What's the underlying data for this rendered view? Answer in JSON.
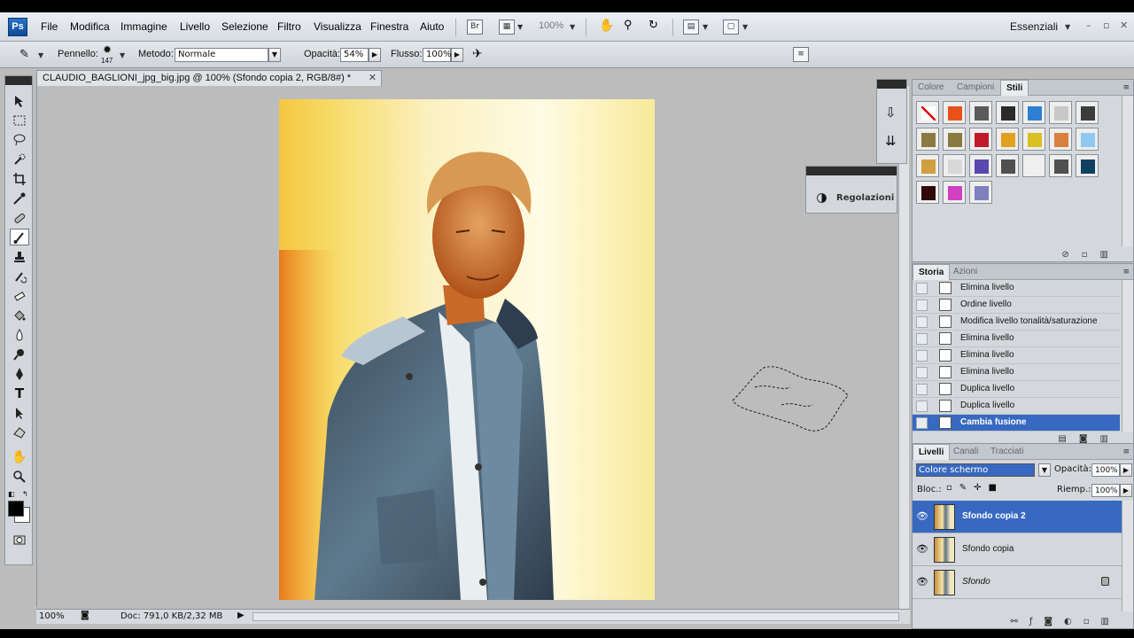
{
  "menubar": {
    "logo": "Ps",
    "items": [
      "File",
      "Modifica",
      "Immagine",
      "Livello",
      "Selezione",
      "Filtro",
      "Visualizza",
      "Finestra",
      "Aiuto"
    ],
    "bridge_label": "Br",
    "zoom": "100%",
    "workspace": "Essenziali",
    "window_controls": [
      "–",
      "▫",
      "✕"
    ]
  },
  "options": {
    "brush_label": "Pennello:",
    "brush_size": "147",
    "mode_label": "Metodo:",
    "mode_value": "Normale",
    "opacity_label": "Opacità:",
    "opacity_value": "54%",
    "flow_label": "Flusso:",
    "flow_value": "100%"
  },
  "document": {
    "tab_title": "CLAUDIO_BAGLIONI_jpg_big.jpg @ 100% (Sfondo copia 2, RGB/8#) *",
    "close": "✕",
    "status_zoom": "100%",
    "status_doc": "Doc: 791,0 KB/2,32 MB"
  },
  "regolazioni": {
    "label": "Regolazioni"
  },
  "swatch_panel": {
    "tabs": [
      "Colore",
      "Campioni",
      "Stili"
    ],
    "active_tab": "Stili",
    "swatch_colors": [
      "#ffffff",
      "#e8521a",
      "#5a5a5a",
      "#2a2a2a",
      "#2f7fd2",
      "#c8c8c8",
      "#3c3c3c",
      "#8a7a40",
      "#8a7a40",
      "#c01a2a",
      "#e0a020",
      "#d8c020",
      "#d88040",
      "#90c8f0",
      "#d0a040",
      "#d8d8d8",
      "#5848b0",
      "#505050",
      "#f0f0f0",
      "#505050",
      "#104060",
      "#300808",
      "#d040c0",
      "#8080c0"
    ]
  },
  "history_panel": {
    "tabs": [
      "Storia",
      "Azioni"
    ],
    "items": [
      "Elimina livello",
      "Ordine livello",
      "Modifica livello tonalità/saturazione",
      "Elimina livello",
      "Elimina livello",
      "Elimina livello",
      "Duplica livello",
      "Duplica livello",
      "Cambia fusione"
    ],
    "selected_index": 8
  },
  "layers_panel": {
    "tabs": [
      "Livelli",
      "Canali",
      "Tracciati"
    ],
    "blend_mode": "Colore schermo",
    "opacity_label": "Opacità:",
    "opacity_value": "100%",
    "lock_label": "Bloc.:",
    "fill_label": "Riemp.:",
    "fill_value": "100%",
    "layers": [
      {
        "name": "Sfondo copia 2",
        "selected": true
      },
      {
        "name": "Sfondo copia",
        "selected": false
      },
      {
        "name": "Sfondo",
        "selected": false,
        "locked": true
      }
    ]
  }
}
